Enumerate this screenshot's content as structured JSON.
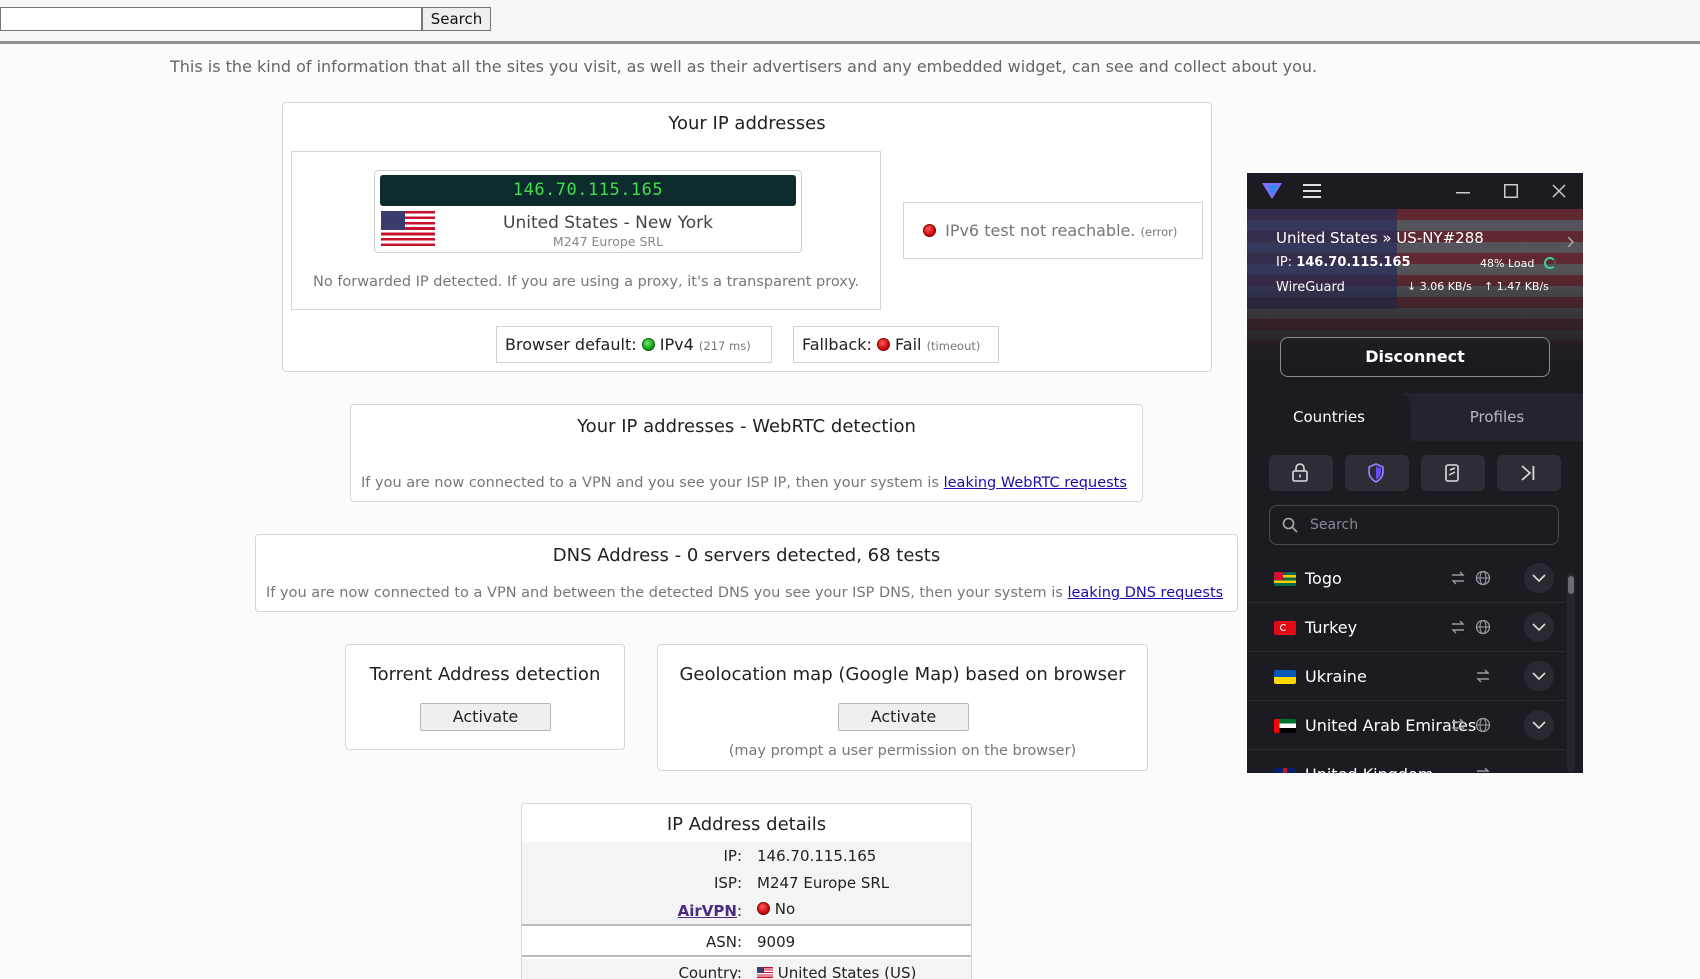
{
  "search": {
    "value": "",
    "button_label": "Search"
  },
  "intro_text": "This is the kind of information that all the sites you visit, as well as their advertisers and any embedded widget, can see and collect about you.",
  "ip_box": {
    "title": "Your IP addresses",
    "ip": "146.70.115.165",
    "location": "United States - New York",
    "isp": "M247 Europe SRL",
    "forwarded_note": "No forwarded IP detected. If you are using a proxy, it's a transparent proxy.",
    "ipv6_text": "IPv6 test not reachable.",
    "ipv6_note": "(error)",
    "browser_default_label": "Browser default:",
    "browser_default_value": "IPv4",
    "browser_default_note": "(217 ms)",
    "fallback_label": "Fallback:",
    "fallback_value": "Fail",
    "fallback_note": "(timeout)"
  },
  "webrtc_box": {
    "title": "Your IP addresses - WebRTC detection",
    "note": "If you are now connected to a VPN and you see your ISP IP, then your system is",
    "link": "leaking WebRTC requests"
  },
  "dns_box": {
    "title": "DNS Address - 0 servers detected, 68 tests",
    "note": "If you are now connected to a VPN and between the detected DNS you see your ISP DNS, then your system is",
    "link": "leaking DNS requests"
  },
  "torrent_box": {
    "title": "Torrent Address detection",
    "button": "Activate"
  },
  "geo_box": {
    "title": "Geolocation map (Google Map) based on browser",
    "button": "Activate",
    "note": "(may prompt a user permission on the browser)"
  },
  "details_box": {
    "title": "IP Address details",
    "rows": [
      {
        "key": "IP:",
        "value": "146.70.115.165"
      },
      {
        "key": "ISP:",
        "value": "M247 Europe SRL"
      },
      {
        "key": "AirVPN",
        "key_suffix": ":",
        "value": "No"
      },
      {
        "key": "ASN:",
        "value": "9009"
      },
      {
        "key": "Country:",
        "value": "United States (US)"
      }
    ]
  },
  "vpn": {
    "server": "United States » US-NY#288",
    "ip_label": "IP:",
    "ip": "146.70.115.165",
    "load": "48% Load",
    "protocol": "WireGuard",
    "down": "3.06 KB/s",
    "up": "1.47 KB/s",
    "disconnect": "Disconnect",
    "tabs": [
      "Countries",
      "Profiles"
    ],
    "search_placeholder": "Search",
    "countries": [
      {
        "name": "Togo"
      },
      {
        "name": "Turkey"
      },
      {
        "name": "Ukraine"
      },
      {
        "name": "United Arab Emirates"
      },
      {
        "name": "United Kingdom"
      }
    ],
    "colors": {
      "accent": "#6d4aff",
      "background": "#1c1b22"
    }
  }
}
